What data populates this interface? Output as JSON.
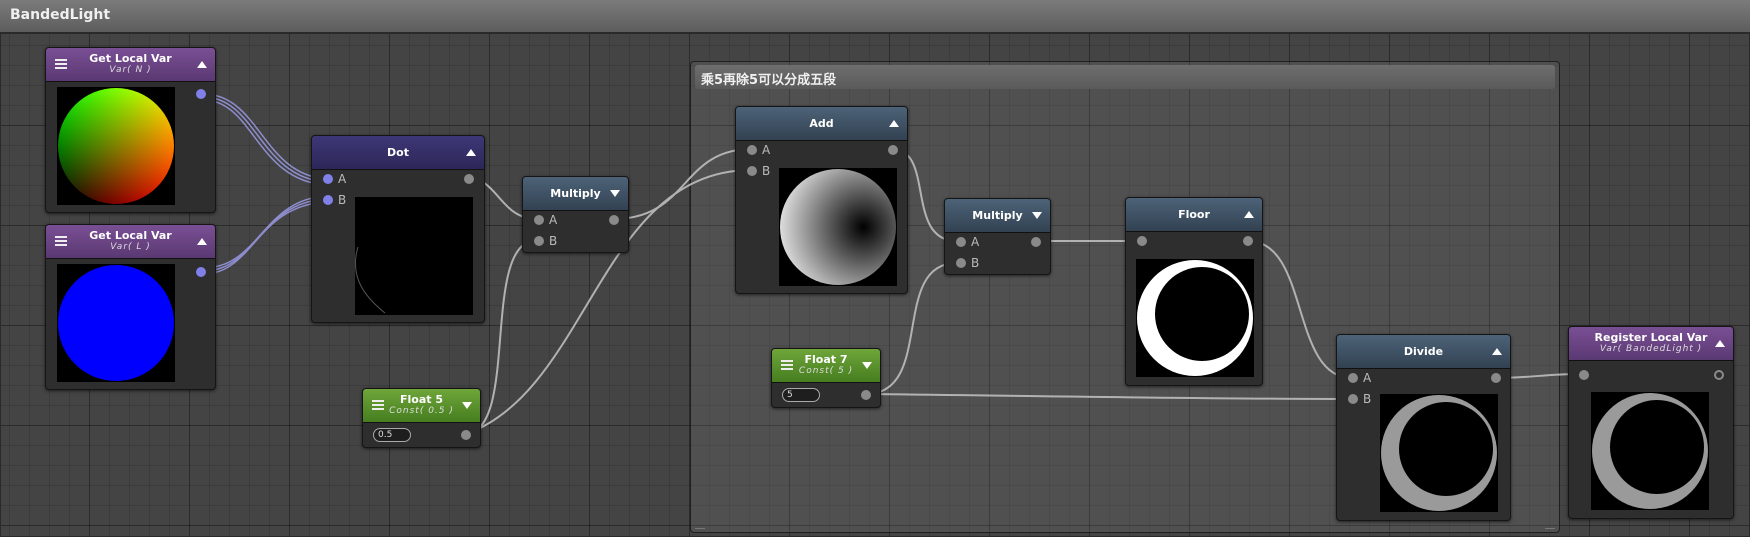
{
  "window": {
    "title": "BandedLight"
  },
  "group": {
    "title": "乘5再除5可以分成五段"
  },
  "nodes": {
    "get_n": {
      "title": "Get Local Var",
      "subtitle": "Var( N )"
    },
    "get_l": {
      "title": "Get Local Var",
      "subtitle": "Var( L )"
    },
    "dot": {
      "title": "Dot",
      "ports": {
        "a": "A",
        "b": "B"
      }
    },
    "multiply1": {
      "title": "Multiply",
      "ports": {
        "a": "A",
        "b": "B"
      }
    },
    "float5": {
      "title": "Float 5",
      "subtitle": "Const( 0.5 )",
      "value": "0.5"
    },
    "add": {
      "title": "Add",
      "ports": {
        "a": "A",
        "b": "B"
      }
    },
    "float7": {
      "title": "Float 7",
      "subtitle": "Const( 5 )",
      "value": "5"
    },
    "multiply2": {
      "title": "Multiply",
      "ports": {
        "a": "A",
        "b": "B"
      }
    },
    "floor": {
      "title": "Floor"
    },
    "divide": {
      "title": "Divide",
      "ports": {
        "a": "A",
        "b": "B"
      }
    },
    "register": {
      "title": "Register Local Var",
      "subtitle": "Var( BandedLight )"
    }
  },
  "colors": {
    "var_header": "#6a4585",
    "dot_header": "#353068",
    "math_header": "#3f5265",
    "float_header": "#5b9230",
    "port_vector": "#8080e8",
    "port_scalar": "#8a8a8a"
  }
}
